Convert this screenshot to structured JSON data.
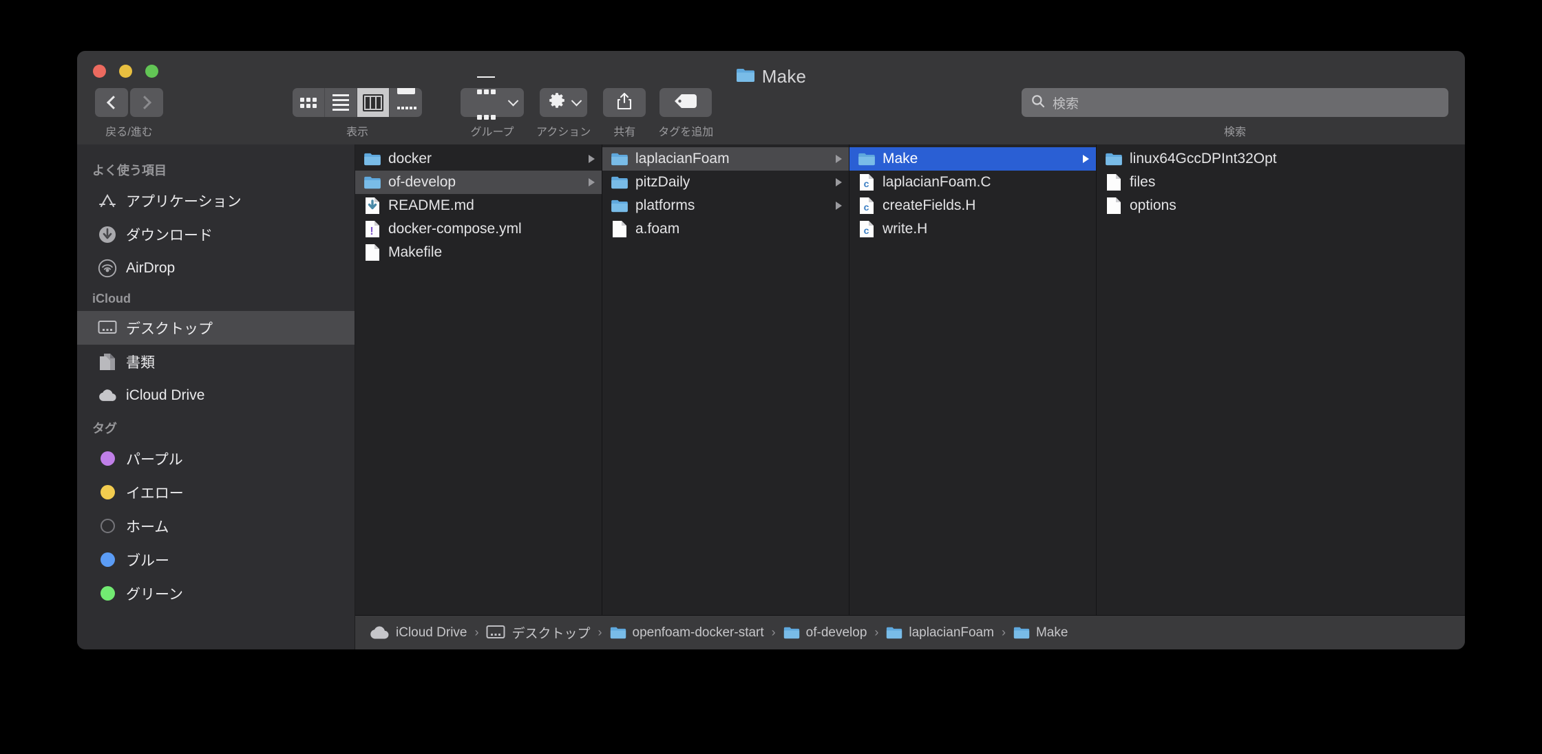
{
  "window": {
    "title": "Make",
    "traffic_lights": [
      "close",
      "minimize",
      "zoom"
    ]
  },
  "toolbar": {
    "nav": {
      "label": "戻る/進む",
      "back_icon": "chevron-left-icon",
      "forward_icon": "chevron-right-icon"
    },
    "view": {
      "label": "表示",
      "modes": [
        {
          "name": "icon-view",
          "icon": "grid-icon",
          "active": false
        },
        {
          "name": "list-view",
          "icon": "list-icon",
          "active": false
        },
        {
          "name": "column-view",
          "icon": "columns-icon",
          "active": true
        },
        {
          "name": "gallery-view",
          "icon": "gallery-icon",
          "active": false
        }
      ]
    },
    "group": {
      "label": "グループ",
      "icon": "group-grid-icon",
      "chevron": "chevron-down-icon"
    },
    "action": {
      "label": "アクション",
      "icon": "gear-icon",
      "chevron": "chevron-down-icon"
    },
    "share": {
      "label": "共有",
      "icon": "share-icon"
    },
    "tag": {
      "label": "タグを追加",
      "icon": "tag-icon"
    },
    "search": {
      "label": "検索",
      "placeholder": "検索",
      "value": "",
      "icon": "search-icon"
    }
  },
  "sidebar": {
    "sections": [
      {
        "header": "よく使う項目",
        "items": [
          {
            "label": "アプリケーション",
            "icon": "applications-icon",
            "selected": false
          },
          {
            "label": "ダウンロード",
            "icon": "downloads-icon",
            "selected": false
          },
          {
            "label": "AirDrop",
            "icon": "airdrop-icon",
            "selected": false
          }
        ]
      },
      {
        "header": "iCloud",
        "items": [
          {
            "label": "デスクトップ",
            "icon": "desktop-icon",
            "selected": true
          },
          {
            "label": "書類",
            "icon": "documents-icon",
            "selected": false
          },
          {
            "label": "iCloud Drive",
            "icon": "cloud-icon",
            "selected": false
          }
        ]
      },
      {
        "header": "タグ",
        "items": [
          {
            "label": "パープル",
            "icon": "tag-dot-icon",
            "color": "#c07fe8",
            "selected": false
          },
          {
            "label": "イエロー",
            "icon": "tag-dot-icon",
            "color": "#f2cc4f",
            "selected": false
          },
          {
            "label": "ホーム",
            "icon": "tag-dot-icon",
            "color": "none",
            "selected": false
          },
          {
            "label": "ブルー",
            "icon": "tag-dot-icon",
            "color": "#5b9cf5",
            "selected": false
          },
          {
            "label": "グリーン",
            "icon": "tag-dot-icon",
            "color": "#72ea72",
            "selected": false
          }
        ]
      }
    ]
  },
  "columns": [
    {
      "items": [
        {
          "name": "docker",
          "type": "folder",
          "arrow": true,
          "state": "none"
        },
        {
          "name": "of-develop",
          "type": "folder",
          "arrow": true,
          "state": "selected-inactive"
        },
        {
          "name": "README.md",
          "type": "file-download",
          "arrow": false,
          "state": "none"
        },
        {
          "name": "docker-compose.yml",
          "type": "file-alert",
          "arrow": false,
          "state": "none"
        },
        {
          "name": "Makefile",
          "type": "file-plain",
          "arrow": false,
          "state": "none"
        }
      ]
    },
    {
      "items": [
        {
          "name": "laplacianFoam",
          "type": "folder",
          "arrow": true,
          "state": "selected-inactive"
        },
        {
          "name": "pitzDaily",
          "type": "folder",
          "arrow": true,
          "state": "none"
        },
        {
          "name": "platforms",
          "type": "folder",
          "arrow": true,
          "state": "none"
        },
        {
          "name": "a.foam",
          "type": "file-plain",
          "arrow": false,
          "state": "none"
        }
      ]
    },
    {
      "items": [
        {
          "name": "Make",
          "type": "folder",
          "arrow": true,
          "state": "selected-active"
        },
        {
          "name": "laplacianFoam.C",
          "type": "file-c",
          "arrow": false,
          "state": "none"
        },
        {
          "name": "createFields.H",
          "type": "file-c",
          "arrow": false,
          "state": "none"
        },
        {
          "name": "write.H",
          "type": "file-c",
          "arrow": false,
          "state": "none"
        }
      ]
    },
    {
      "items": [
        {
          "name": "linux64GccDPInt32Opt",
          "type": "folder",
          "arrow": false,
          "state": "none"
        },
        {
          "name": "files",
          "type": "file-plain",
          "arrow": false,
          "state": "none"
        },
        {
          "name": "options",
          "type": "file-plain",
          "arrow": false,
          "state": "none"
        }
      ]
    }
  ],
  "pathbar": {
    "crumbs": [
      {
        "label": "iCloud Drive",
        "icon": "cloud-icon"
      },
      {
        "label": "デスクトップ",
        "icon": "desktop-icon"
      },
      {
        "label": "openfoam-docker-start",
        "icon": "folder-icon"
      },
      {
        "label": "of-develop",
        "icon": "folder-icon"
      },
      {
        "label": "laplacianFoam",
        "icon": "folder-icon"
      },
      {
        "label": "Make",
        "icon": "folder-icon"
      }
    ],
    "separator": "›"
  },
  "colors": {
    "selection_active": "#2a5fd4",
    "selection_inactive": "#4a4a4d",
    "folder_blue": "#6aaede",
    "toolbar_bg": "#373739",
    "sidebar_bg": "#2e2e31",
    "column_bg": "#232325"
  }
}
